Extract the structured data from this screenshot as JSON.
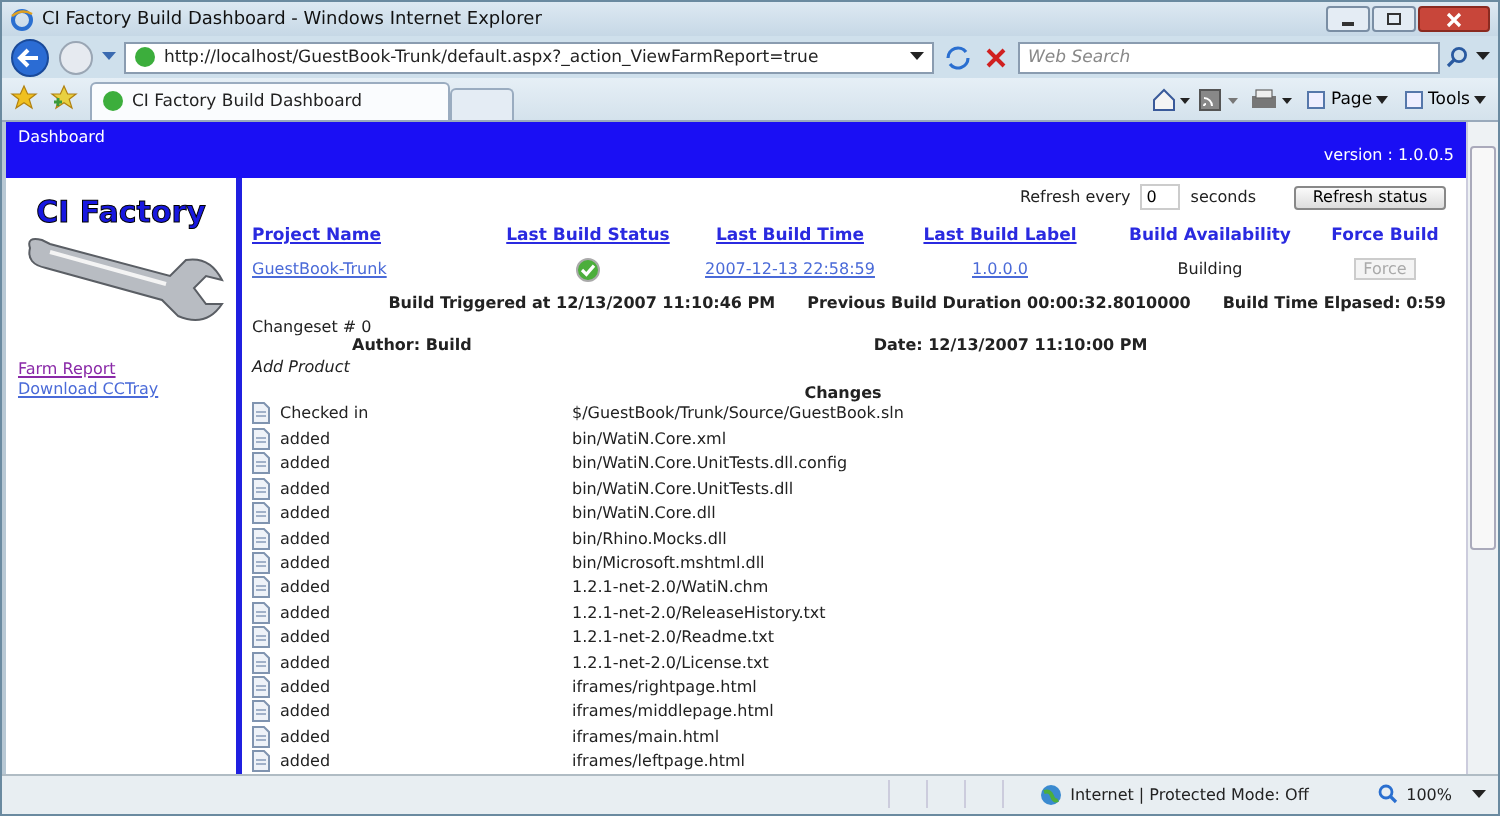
{
  "window": {
    "title": "CI Factory Build Dashboard - Windows Internet Explorer"
  },
  "navigation": {
    "address": "http://localhost/GuestBook-Trunk/default.aspx?_action_ViewFarmReport=true",
    "search_placeholder": "Web Search"
  },
  "tabs": [
    {
      "label": "CI Factory Build Dashboard",
      "selected": true
    }
  ],
  "commands": [
    {
      "kind": "home"
    },
    {
      "kind": "feeds"
    },
    {
      "kind": "print"
    },
    {
      "kind": "menu",
      "label": "Page"
    },
    {
      "kind": "menu",
      "label": "Tools"
    }
  ],
  "header": {
    "title": "Dashboard",
    "version": "version : 1.0.0.5"
  },
  "sidebar": {
    "logo_text": "CI Factory",
    "links": [
      {
        "label": "Farm Report",
        "visited": true
      },
      {
        "label": "Download CCTray",
        "visited": false
      }
    ]
  },
  "refresh": {
    "label": "Refresh every",
    "value": "0",
    "unit": "seconds",
    "button": "Refresh status"
  },
  "table": {
    "columns": [
      "Project Name",
      "Last Build Status",
      "Last Build Time",
      "Last Build Label",
      "Build Availability",
      "Force Build"
    ],
    "row": {
      "project": "GuestBook-Trunk",
      "time": "2007-12-13 22:58:59",
      "label": "1.0.0.0",
      "availability": "Building",
      "force": "Force",
      "force_disabled": true
    }
  },
  "build_info": [
    "Build Triggered at 12/13/2007 11:10:46 PM",
    "Previous Build Duration 00:00:32.8010000",
    "Build Time Elpased: 0:59"
  ],
  "changeset": {
    "title": "Changeset # 0",
    "author": "Author: Build",
    "date": "Date: 12/13/2007 11:10:00 PM",
    "comment": "Add Product",
    "heading": "Changes",
    "changes": [
      {
        "action": "Checked in",
        "path": "$/GuestBook/Trunk/Source/GuestBook.sln"
      },
      {
        "action": "added",
        "path": "bin/WatiN.Core.xml"
      },
      {
        "action": "added",
        "path": "bin/WatiN.Core.UnitTests.dll.config"
      },
      {
        "action": "added",
        "path": "bin/WatiN.Core.UnitTests.dll"
      },
      {
        "action": "added",
        "path": "bin/WatiN.Core.dll"
      },
      {
        "action": "added",
        "path": "bin/Rhino.Mocks.dll"
      },
      {
        "action": "added",
        "path": "bin/Microsoft.mshtml.dll"
      },
      {
        "action": "added",
        "path": "1.2.1-net-2.0/WatiN.chm"
      },
      {
        "action": "added",
        "path": "1.2.1-net-2.0/ReleaseHistory.txt"
      },
      {
        "action": "added",
        "path": "1.2.1-net-2.0/Readme.txt"
      },
      {
        "action": "added",
        "path": "1.2.1-net-2.0/License.txt"
      },
      {
        "action": "added",
        "path": "iframes/rightpage.html"
      },
      {
        "action": "added",
        "path": "iframes/middlepage.html"
      },
      {
        "action": "added",
        "path": "iframes/main.html"
      },
      {
        "action": "added",
        "path": "iframes/leftpage.html"
      }
    ]
  },
  "status_bar": {
    "zone": "Internet | Protected Mode: Off",
    "zoom": "100%"
  }
}
